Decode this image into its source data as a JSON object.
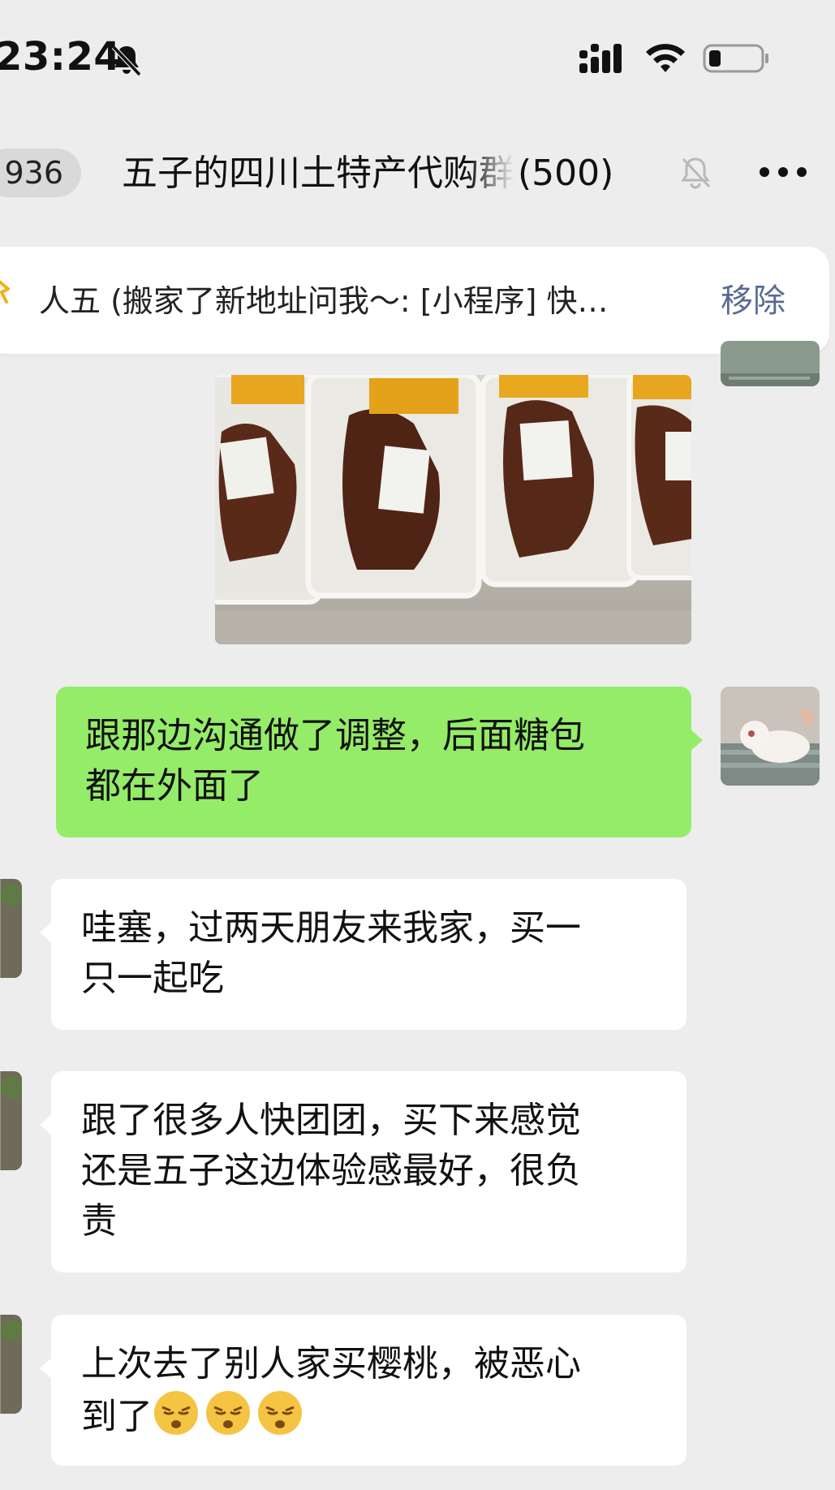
{
  "status_bar": {
    "time": "23:24",
    "icons": [
      "bell-slash-icon",
      "signal-icon",
      "wifi-icon",
      "battery-icon"
    ]
  },
  "header": {
    "back_badge": "936",
    "title": "五子的四川土特产代购群",
    "member_count": "(500)",
    "icons": [
      "mute-bell-icon",
      "more-icon"
    ]
  },
  "pinned": {
    "text": "人五 (搬家了新地址问我～: [小程序] 快…",
    "action": "移除"
  },
  "messages": [
    {
      "type": "image",
      "side": "right",
      "description_icon": "photo-roast-duck"
    },
    {
      "side": "right",
      "text": "跟那边沟通做了调整，后面糖包\n都在外面了"
    },
    {
      "side": "left",
      "text": "哇塞，过两天朋友来我家，买一\n只一起吃"
    },
    {
      "side": "left",
      "text": "跟了很多人快团团，买下来感觉\n还是五子这边体验感最好，很负\n责"
    },
    {
      "side": "left",
      "text": "上次去了别人家买樱桃，被恶心\n到了",
      "emoji_count": 3
    }
  ],
  "colors": {
    "background": "#ededed",
    "sent_bubble": "#95ec69",
    "received_bubble": "#ffffff",
    "link_action": "#576b95"
  }
}
